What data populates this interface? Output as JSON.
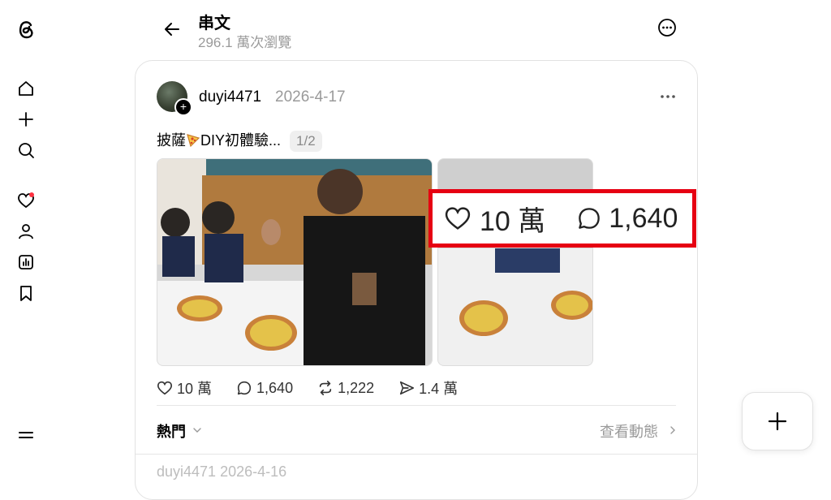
{
  "header": {
    "title": "串文",
    "views": "296.1 萬次瀏覽"
  },
  "sidebar": {
    "items": [
      {
        "name": "home-icon"
      },
      {
        "name": "plus-icon"
      },
      {
        "name": "search-icon"
      },
      {
        "name": "heart-icon"
      },
      {
        "name": "profile-icon"
      },
      {
        "name": "insights-icon"
      },
      {
        "name": "bookmark-icon"
      }
    ]
  },
  "post": {
    "username": "duyi4471",
    "date": "2026-4-17",
    "text": "披薩",
    "text_rest": "DIY初體驗...",
    "page_badge": "1/2",
    "likes": "10 萬",
    "comments": "1,640",
    "reposts": "1,222",
    "shares": "1.4 萬"
  },
  "footer": {
    "sort_label": "熱門",
    "view_activity": "查看動態"
  },
  "next_post_preview": "duyi4471 2026-4-16",
  "highlight": {
    "likes": "10 萬",
    "comments": "1,640",
    "border_color": "#e60012"
  }
}
